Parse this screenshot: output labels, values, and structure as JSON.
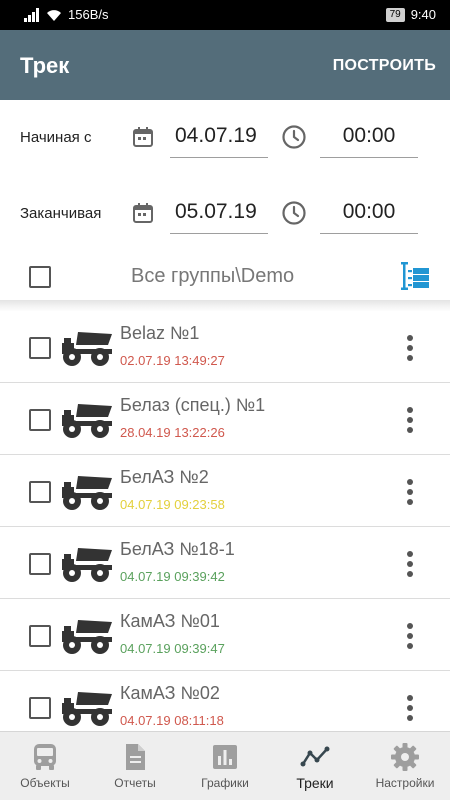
{
  "status_bar": {
    "net_speed": "156B/s",
    "battery": "79",
    "time": "9:40"
  },
  "app_bar": {
    "title": "Трек",
    "action_label": "ПОСТРОИТЬ"
  },
  "period": {
    "start": {
      "label": "Начиная с",
      "date": "04.07.19",
      "time": "00:00"
    },
    "end": {
      "label": "Заканчивая",
      "date": "05.07.19",
      "time": "00:00"
    }
  },
  "group": {
    "label": "Все группы\\Demo"
  },
  "vehicles": [
    {
      "name": "Belaz №1",
      "time": "02.07.19 13:49:27",
      "status_color": "#d0584d"
    },
    {
      "name": "Белаз (спец.) №1",
      "time": "28.04.19 13:22:26",
      "status_color": "#d0584d"
    },
    {
      "name": "БелАЗ №2",
      "time": "04.07.19 09:23:58",
      "status_color": "#e3d03c"
    },
    {
      "name": "БелАЗ №18-1",
      "time": "04.07.19 09:39:42",
      "status_color": "#5aa15d"
    },
    {
      "name": "КамАЗ №01",
      "time": "04.07.19 09:39:47",
      "status_color": "#5aa15d"
    },
    {
      "name": "КамАЗ №02",
      "time": "04.07.19 08:11:18",
      "status_color": "#d0584d"
    }
  ],
  "nav": {
    "items": [
      {
        "label": "Объекты",
        "icon": "bus-icon"
      },
      {
        "label": "Отчеты",
        "icon": "document-icon"
      },
      {
        "label": "Графики",
        "icon": "bar-chart-icon"
      },
      {
        "label": "Треки",
        "icon": "track-line-icon"
      },
      {
        "label": "Настройки",
        "icon": "gear-icon"
      }
    ],
    "active_index": 3
  },
  "colors": {
    "app_bar": "#546d7a",
    "accent": "#2196d3",
    "nav_active": "#37474f",
    "nav_inactive": "#9e9e9e"
  }
}
